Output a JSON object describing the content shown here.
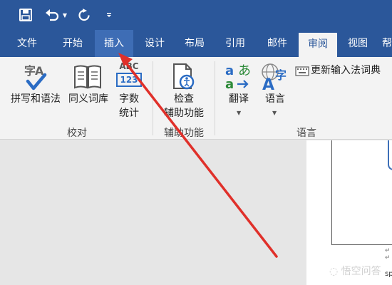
{
  "quick_access": {
    "icons": [
      "save-icon",
      "undo-icon",
      "undo-dropdown-icon",
      "redo-icon",
      "customize-icon"
    ]
  },
  "tabs": [
    "文件",
    "开始",
    "插入",
    "设计",
    "布局",
    "引用",
    "邮件",
    "审阅",
    "视图",
    "帮"
  ],
  "active_tab": "审阅",
  "hovered_tab": "插入",
  "ribbon": {
    "proofing": {
      "spelling_label": "拼写和语法",
      "thesaurus_label": "同义词库",
      "wordcount_label_1": "字数",
      "wordcount_label_2": "统计",
      "group_label": "校对"
    },
    "accessibility": {
      "check_label_1": "检查",
      "check_label_2": "辅助功能",
      "group_label": "辅助功能"
    },
    "language": {
      "translate_label": "翻译",
      "language_label": "语言",
      "ime_dict_label": "更新输入法词典",
      "group_label": "语言"
    }
  },
  "icon_text": {
    "spelling_glyph": "字A",
    "wordcount_top": "ABC",
    "wordcount_bottom": "123",
    "language_glyph": "字"
  },
  "document": {
    "paragraph_mark": "↵",
    "edge_text": "sp"
  },
  "watermark": "悟空问答",
  "colors": {
    "title_bar": "#2b579a",
    "ribbon": "#f3f3f3",
    "arrow": "#e0302a"
  }
}
